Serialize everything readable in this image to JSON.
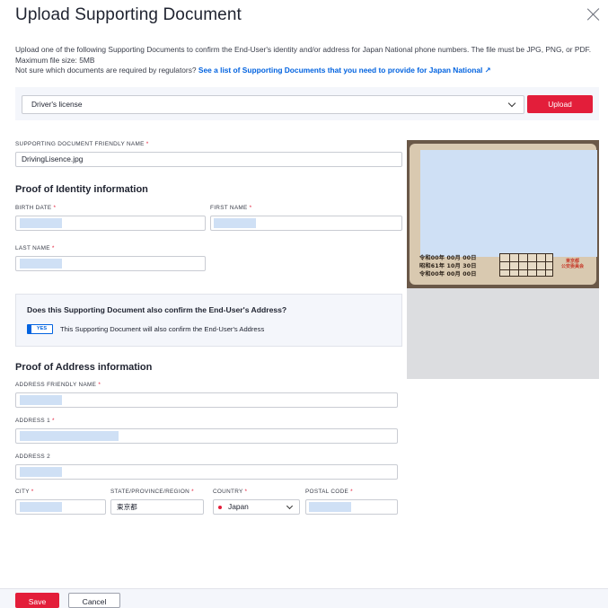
{
  "modal": {
    "title": "Upload Supporting Document",
    "close_icon": "close-icon"
  },
  "intro": {
    "text": "Upload one of the following Supporting Documents to confirm the End-User's identity and/or address for Japan National phone numbers. The file must be JPG, PNG, or PDF. Maximum file size: 5MB",
    "prompt": "Not sure which documents are required by regulators?",
    "link_text": "See a list of Supporting Documents that you need to provide for Japan National ↗"
  },
  "document_type": {
    "selected": "Driver's license",
    "upload_label": "Upload"
  },
  "friendly_name": {
    "label": "SUPPORTING DOCUMENT FRIENDLY NAME",
    "value": "DrivingLisence.jpg"
  },
  "identity": {
    "heading": "Proof of Identity information",
    "birth_date_label": "BIRTH DATE",
    "first_name_label": "FIRST NAME",
    "last_name_label": "LAST NAME"
  },
  "address_confirm": {
    "question": "Does this Supporting Document also confirm the End-User's Address?",
    "toggle_label": "YES",
    "toggle_text": "This Supporting Document will also confirm the End-User's Address"
  },
  "address": {
    "heading": "Proof of Address information",
    "friendly_name_label": "ADDRESS FRIENDLY NAME",
    "address1_label": "ADDRESS 1",
    "address2_label": "ADDRESS 2",
    "city_label": "CITY",
    "state_label": "STATE/PROVINCE/REGION",
    "state_value": "東京都",
    "country_label": "COUNTRY",
    "country_value": "Japan",
    "postal_label": "POSTAL CODE"
  },
  "license_card": {
    "row1": "令和00年 00月 00日",
    "row2": "昭和61年 10月 30日",
    "row3": "令和00年 00月 00日",
    "stamp_line1": "東京都",
    "stamp_line2": "公安委員会"
  },
  "footer": {
    "save_label": "Save",
    "cancel_label": "Cancel"
  },
  "colors": {
    "primary": "#e31e3a",
    "link": "#0263e0",
    "redaction": "#cfe0f5"
  }
}
